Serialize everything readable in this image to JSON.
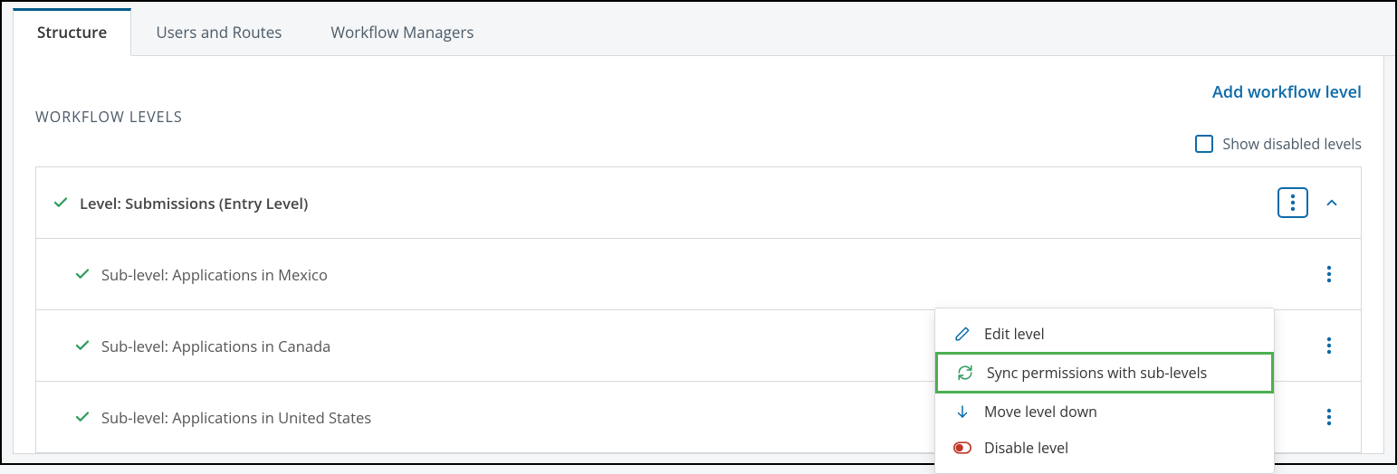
{
  "tabs": {
    "structure": "Structure",
    "users_routes": "Users and Routes",
    "workflow_managers": "Workflow Managers"
  },
  "section_title": "WORKFLOW LEVELS",
  "add_link": "Add workflow level",
  "show_disabled_label": "Show disabled levels",
  "levels": {
    "main": "Level: Submissions (Entry Level)",
    "sub1": "Sub-level: Applications in Mexico",
    "sub2": "Sub-level: Applications in Canada",
    "sub3": "Sub-level: Applications in United States"
  },
  "menu": {
    "edit": "Edit level",
    "sync": "Sync permissions with sub-levels",
    "move_down": "Move level down",
    "disable": "Disable level"
  }
}
